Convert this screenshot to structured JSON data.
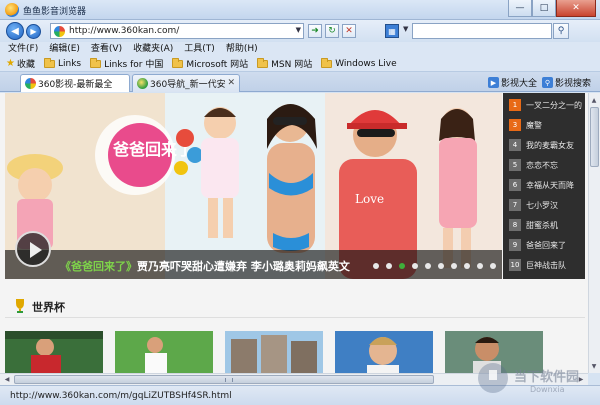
{
  "window": {
    "title": "鱼鱼影音浏览器",
    "min": "—",
    "max": "□",
    "close": "✕"
  },
  "address": {
    "url": "http://www.360kan.com/"
  },
  "menu": [
    "文件(F)",
    "编辑(E)",
    "查看(V)",
    "收藏夹(A)",
    "工具(T)",
    "帮助(H)"
  ],
  "favorites": {
    "label": "收藏",
    "items": [
      "Links",
      "Links for 中国",
      "Microsoft 网站",
      "MSN 网站",
      "Windows Live"
    ]
  },
  "tabs": [
    {
      "label": "360影视-最新最全",
      "active": true
    },
    {
      "label": "360导航_新一代安",
      "active": false
    }
  ],
  "tab_right": {
    "all": "影视大全",
    "search": "影视搜索"
  },
  "banner": {
    "logo_text": "爸爸回来了",
    "caption_highlight": "《爸爸回来了》",
    "caption_text": "贾乃亮吓哭甜心遭嫌弃 李小璐奥莉妈飙英文",
    "dots": 10,
    "active_dot": 3
  },
  "ranking": [
    {
      "num": "1",
      "title": "一叉二分之一的"
    },
    {
      "num": "3",
      "title": "魔警"
    },
    {
      "num": "4",
      "title": "我的麦霸女友"
    },
    {
      "num": "5",
      "title": "恋恋不忘"
    },
    {
      "num": "6",
      "title": "幸福从天而降"
    },
    {
      "num": "7",
      "title": "七小罗汉"
    },
    {
      "num": "8",
      "title": "甜蜜杀机"
    },
    {
      "num": "9",
      "title": "爸爸回来了"
    },
    {
      "num": "10",
      "title": "巨神战击队"
    }
  ],
  "section": {
    "title": "世界杯"
  },
  "status": {
    "url": "http://www.360kan.com/m/gqLiZUTBSHf4SR.html"
  },
  "watermark": {
    "main": "当下软件园",
    "sub": "Downxia"
  }
}
